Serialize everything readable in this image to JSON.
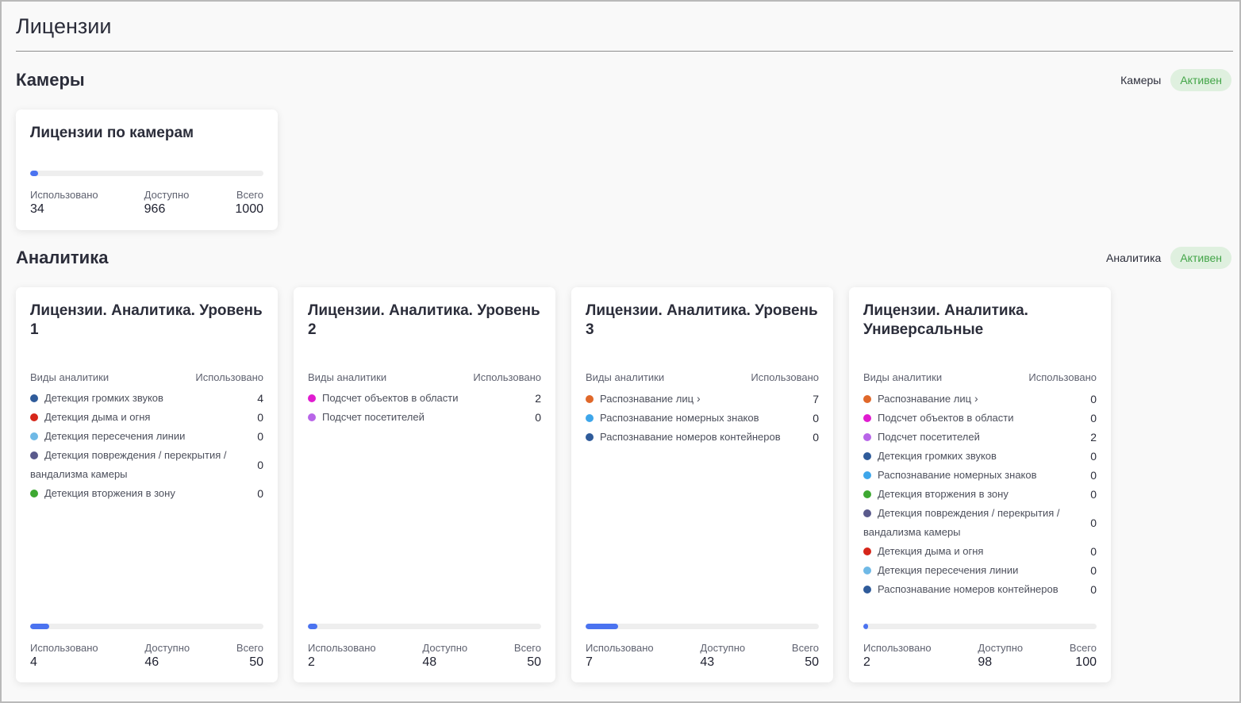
{
  "page": {
    "title": "Лицензии"
  },
  "colors": {
    "accent": "#4b73f0",
    "badge_bg": "#dff0df",
    "badge_text": "#43a548"
  },
  "cameras": {
    "section_title": "Камеры",
    "status_label": "Камеры",
    "status_badge": "Активен",
    "card": {
      "title": "Лицензии по камерам",
      "used_label": "Использовано",
      "used": "34",
      "available_label": "Доступно",
      "available": "966",
      "total_label": "Всего",
      "total": "1000",
      "fill_fraction": 0.034
    }
  },
  "analytics": {
    "section_title": "Аналитика",
    "status_label": "Аналитика",
    "status_badge": "Активен",
    "cards": [
      {
        "title": "Лицензии. Аналитика. Уровень 1",
        "types_label": "Виды аналитики",
        "used_col_label": "Использовано",
        "items": [
          {
            "name": "Детекция громких звуков",
            "count": "4",
            "color": "#2f5b9a"
          },
          {
            "name": "Детекция дыма и огня",
            "count": "0",
            "color": "#d6261a"
          },
          {
            "name": "Детекция пересечения линии",
            "count": "0",
            "color": "#6fb9e6"
          },
          {
            "name": "Детекция повреждения / перекрытия / вандализма камеры",
            "count": "0",
            "color": "#5a5a8c"
          },
          {
            "name": "Детекция вторжения в зону",
            "count": "0",
            "color": "#3ea832"
          }
        ],
        "used_label": "Использовано",
        "used": "4",
        "available_label": "Доступно",
        "available": "46",
        "total_label": "Всего",
        "total": "50",
        "fill_fraction": 0.08
      },
      {
        "title": "Лицензии. Аналитика. Уровень 2",
        "types_label": "Виды аналитики",
        "used_col_label": "Использовано",
        "items": [
          {
            "name": "Подсчет объектов в области",
            "count": "2",
            "color": "#e01cd0"
          },
          {
            "name": "Подсчет посетителей",
            "count": "0",
            "color": "#b865e8"
          }
        ],
        "used_label": "Использовано",
        "used": "2",
        "available_label": "Доступно",
        "available": "48",
        "total_label": "Всего",
        "total": "50",
        "fill_fraction": 0.04
      },
      {
        "title": "Лицензии. Аналитика. Уровень 3",
        "types_label": "Виды аналитики",
        "used_col_label": "Использовано",
        "items": [
          {
            "name": "Распознавание лиц",
            "count": "7",
            "color": "#e0682a",
            "chevron": "chevron-right-icon"
          },
          {
            "name": "Распознавание номерных знаков",
            "count": "0",
            "color": "#3ea6ea"
          },
          {
            "name": "Распознавание номеров контейнеров",
            "count": "0",
            "color": "#2f5b9a"
          }
        ],
        "used_label": "Использовано",
        "used": "7",
        "available_label": "Доступно",
        "available": "43",
        "total_label": "Всего",
        "total": "50",
        "fill_fraction": 0.14
      },
      {
        "title": "Лицензии. Аналитика. Универсальные",
        "types_label": "Виды аналитики",
        "used_col_label": "Использовано",
        "items": [
          {
            "name": "Распознавание лиц",
            "count": "0",
            "color": "#e0682a",
            "chevron": "chevron-right-icon"
          },
          {
            "name": "Подсчет объектов в области",
            "count": "0",
            "color": "#e01cd0"
          },
          {
            "name": "Подсчет посетителей",
            "count": "2",
            "color": "#b865e8"
          },
          {
            "name": "Детекция громких звуков",
            "count": "0",
            "color": "#2f5b9a"
          },
          {
            "name": "Распознавание номерных знаков",
            "count": "0",
            "color": "#3ea6ea"
          },
          {
            "name": "Детекция вторжения в зону",
            "count": "0",
            "color": "#3ea832"
          },
          {
            "name": "Детекция повреждения / перекрытия / вандализма камеры",
            "count": "0",
            "color": "#5a5a8c"
          },
          {
            "name": "Детекция дыма и огня",
            "count": "0",
            "color": "#d6261a"
          },
          {
            "name": "Детекция пересечения линии",
            "count": "0",
            "color": "#6fb9e6"
          },
          {
            "name": "Распознавание номеров контейнеров",
            "count": "0",
            "color": "#2f5b9a"
          }
        ],
        "used_label": "Использовано",
        "used": "2",
        "available_label": "Доступно",
        "available": "98",
        "total_label": "Всего",
        "total": "100",
        "fill_fraction": 0.02
      }
    ]
  }
}
